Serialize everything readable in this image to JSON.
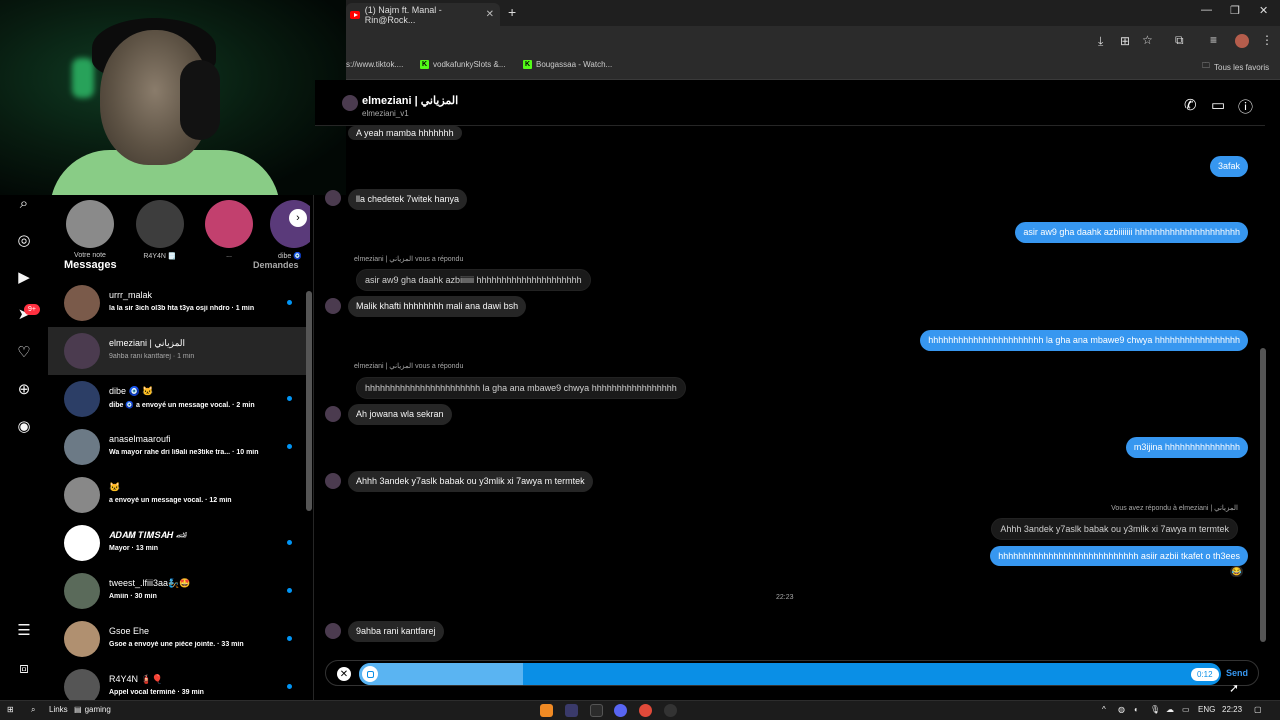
{
  "browser": {
    "tab_title": "(1) Najm ft. Manal - Rin@Rock...",
    "tab_close": "✕",
    "new_tab": "+",
    "window_controls": [
      "—",
      "❐",
      "✕"
    ],
    "toolbar_icons": [
      "download-icon",
      "translate-icon",
      "star-icon",
      "extensions-icon",
      "media-icon",
      "profile-icon",
      "menu-icon"
    ],
    "bookmarks": [
      {
        "label": "s://www.tiktok...."
      },
      {
        "label": "vodkafunkySlots &...",
        "icon": "K"
      },
      {
        "label": "Bougassaa - Watch...",
        "icon": "K"
      }
    ],
    "all_bookmarks": "Tous les favoris"
  },
  "notes": [
    {
      "label": "Votre note"
    },
    {
      "label": "R4Y4N 🗒️"
    },
    {
      "label": "..."
    },
    {
      "label": "dibe 🧿"
    }
  ],
  "messages_panel": {
    "title": "Messages",
    "requests": "Demandes",
    "conversations": [
      {
        "name": "urrr_malak",
        "preview": "la la sir 3ich ol3b hta t3ya osji nhdro · 1 min",
        "unread": true
      },
      {
        "name": "elmeziani | المزياني",
        "preview": "9ahba rani kantfarej · 1 min",
        "unread": false,
        "active": true
      },
      {
        "name": "dibe 🧿 🐱",
        "preview": "dibe 🧿 a envoyé un message vocal. · 2 min",
        "unread": true
      },
      {
        "name": "anaselmaaroufi",
        "preview": "Wa mayor rahe dri li9ali ne3tike tra... · 10 min",
        "unread": true
      },
      {
        "name": "🐱",
        "preview": "a envoyé un message vocal. · 12 min",
        "unread": false
      },
      {
        "name": "𝑨𝑫𝑨𝑴 𝑻𝑰𝑴𝑺𝑨𝑯 🏎",
        "preview": "Mayor · 13 min",
        "unread": true
      },
      {
        "name": "tweest_.lfiii3aa🧞🤩",
        "preview": "Amiin · 30 min",
        "unread": true
      },
      {
        "name": "Gsoe Ehe",
        "preview": "Gsoe a envoyé une pièce jointe. · 33 min",
        "unread": true
      },
      {
        "name": "R4Y4N 🧯🎈",
        "preview": "Appel vocal terminé · 39 min",
        "unread": true
      }
    ]
  },
  "rail": {
    "notification_count": "9+"
  },
  "chat": {
    "name": "elmeziani | المزياني",
    "username": "elmeziani_v1",
    "messages": [
      {
        "text": "A yeah mamba hhhhhhh"
      },
      {
        "text": "3afak"
      },
      {
        "text": "lla chedetek 7witek hanya"
      },
      {
        "text": "asir aw9 gha daahk azbiiiiiii hhhhhhhhhhhhhhhhhhhhh"
      },
      {
        "label": "elmeziani | المزياني vous a répondu"
      },
      {
        "text": "asir aw9 gha daahk azbiiiiiii hhhhhhhhhhhhhhhhhhhhh"
      },
      {
        "text": "Malik khafti hhhhhhhh mali ana dawi bsh"
      },
      {
        "text": "hhhhhhhhhhhhhhhhhhhhhhh la gha ana mbawe9 chwya hhhhhhhhhhhhhhhhh"
      },
      {
        "label": "elmeziani | المزياني vous a répondu"
      },
      {
        "text": "hhhhhhhhhhhhhhhhhhhhhhh la gha ana mbawe9 chwya hhhhhhhhhhhhhhhhh"
      },
      {
        "text": "Ah jowana wla sekran"
      },
      {
        "text": "m3ijina hhhhhhhhhhhhhhh"
      },
      {
        "text": "Ahhh 3andek y7aslk babak ou y3mlik xi 7awya m termtek"
      },
      {
        "label": "Vous avez répondu à elmeziani | المزياني"
      },
      {
        "text": "Ahhh 3andek y7aslk babak ou y3mlik xi 7awya m termtek"
      },
      {
        "text": "hhhhhhhhhhhhhhhhhhhhhhhhhhhh asiir azbii tkafet o th3ees"
      },
      {
        "text": "9ahba rani kantfarej"
      }
    ],
    "reaction": "😂",
    "time": "22:23"
  },
  "recorder": {
    "close": "✕",
    "progress": 0.19,
    "duration": "0:12",
    "send": "Send"
  },
  "taskbar": {
    "links": "Links",
    "folder": "gaming",
    "lang": "ENG",
    "clock": "22:23"
  },
  "colors": {
    "outgoing_bubble": "#3797f0",
    "incoming_bubble": "#262626",
    "recorder": "#0a8fe6",
    "unread_dot": "#0095f6",
    "notification": "#ff3040"
  }
}
